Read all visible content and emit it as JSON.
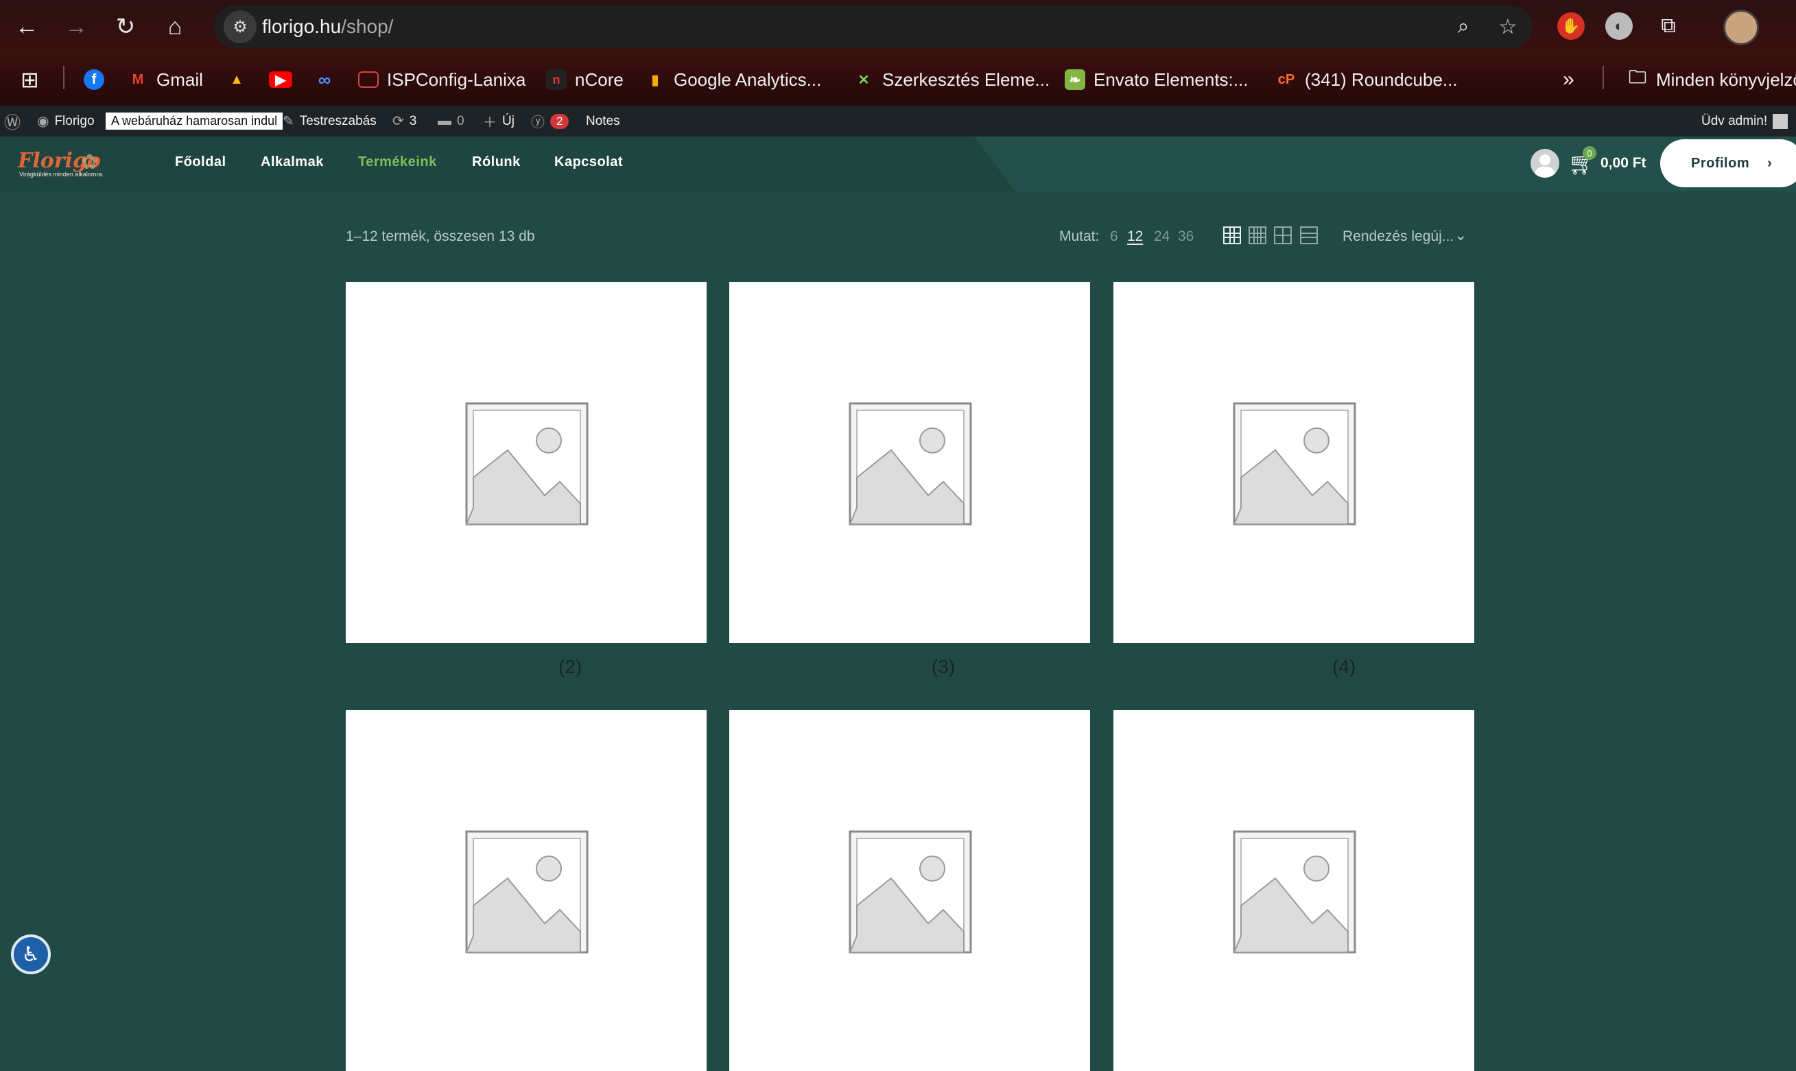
{
  "browser": {
    "url_host": "florigo.hu",
    "url_path": "/shop/",
    "bookmarks": [
      {
        "label": "Gmail",
        "icon": "gmail-icon"
      },
      {
        "label": "ISPConfig-Lanixa",
        "icon": "ispconfig-icon"
      },
      {
        "label": "nCore",
        "icon": "ncore-icon"
      },
      {
        "label": "Google Analytics...",
        "icon": "analytics-icon"
      },
      {
        "label": "Szerkesztés Eleme...",
        "icon": "elementor-icon"
      },
      {
        "label": "Envato Elements:...",
        "icon": "envato-icon"
      },
      {
        "label": "(341) Roundcube...",
        "icon": "cpanel-icon"
      }
    ],
    "all_bookmarks_label": "Minden könyvjelző"
  },
  "admin_bar": {
    "site_name": "Florigo",
    "notice": "A webáruház hamarosan indul",
    "customize": "Testreszabás",
    "updates_count": "3",
    "comments_count": "0",
    "new_label": "Új",
    "yoast_count": "2",
    "notes_label": "Notes",
    "greeting": "Üdv admin!"
  },
  "header": {
    "logo_word": "Florigo",
    "logo_tagline": "Virágküldés minden alkalomra.",
    "menu": [
      {
        "label": "Főoldal",
        "active": false
      },
      {
        "label": "Alkalmak",
        "active": false
      },
      {
        "label": "Termékeink",
        "active": true
      },
      {
        "label": "Rólunk",
        "active": false
      },
      {
        "label": "Kapcsolat",
        "active": false
      }
    ],
    "cart_count": "0",
    "cart_total": "0,00 Ft",
    "profile_label": "Profilom",
    "profile_chevron": "›"
  },
  "toolbar": {
    "result_count": "1–12 termék, összesen 13 db",
    "show_label": "Mutat:",
    "show_options": [
      "6",
      "12",
      "24",
      "36"
    ],
    "show_selected": "12",
    "sort_label": "Rendezés legúj...",
    "sort_caret": "⌄"
  },
  "products": [
    {
      "price": "(2)"
    },
    {
      "price": "(3)"
    },
    {
      "price": "(4)"
    },
    {
      "price": ""
    },
    {
      "price": ""
    },
    {
      "price": ""
    }
  ],
  "colors": {
    "page_bg": "#224a45",
    "header_bg": "#1f4540",
    "active_menu": "#7dc05a",
    "admin_bar_bg": "#1d2327"
  }
}
